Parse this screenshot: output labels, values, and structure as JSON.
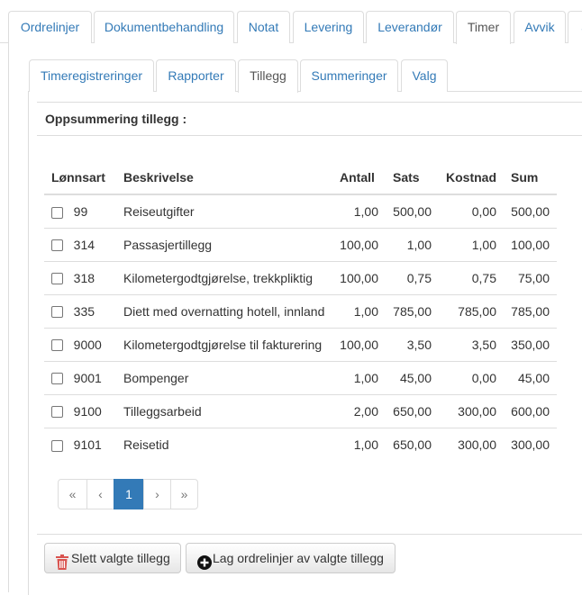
{
  "top_tabs": [
    {
      "label": "Ordrelinjer",
      "active": false
    },
    {
      "label": "Dokumentbehandling",
      "active": false
    },
    {
      "label": "Notat",
      "active": false
    },
    {
      "label": "Levering",
      "active": false
    },
    {
      "label": "Leverandør",
      "active": false
    },
    {
      "label": "Timer",
      "active": true
    },
    {
      "label": "Avvik",
      "active": false
    },
    {
      "label": "S",
      "active": false
    }
  ],
  "sub_tabs": [
    {
      "label": "Timeregistreringer",
      "active": false
    },
    {
      "label": "Rapporter",
      "active": false
    },
    {
      "label": "Tillegg",
      "active": true
    },
    {
      "label": "Summeringer",
      "active": false
    },
    {
      "label": "Valg",
      "active": false
    }
  ],
  "section_title": "Oppsummering tillegg :",
  "table": {
    "headers": [
      "Lønnsart",
      "Beskrivelse",
      "Antall",
      "Sats",
      "Kostnad",
      "Sum"
    ],
    "rows": [
      {
        "code": "99",
        "desc": "Reiseutgifter",
        "antall": "1,00",
        "sats": "500,00",
        "kostnad": "0,00",
        "sum": "500,00"
      },
      {
        "code": "314",
        "desc": "Passasjertillegg",
        "antall": "100,00",
        "sats": "1,00",
        "kostnad": "1,00",
        "sum": "100,00"
      },
      {
        "code": "318",
        "desc": "Kilometergodtgjørelse, trekkpliktig",
        "antall": "100,00",
        "sats": "0,75",
        "kostnad": "0,75",
        "sum": "75,00"
      },
      {
        "code": "335",
        "desc": "Diett med overnatting hotell, innland",
        "antall": "1,00",
        "sats": "785,00",
        "kostnad": "785,00",
        "sum": "785,00"
      },
      {
        "code": "9000",
        "desc": "Kilometergodtgjørelse til fakturering",
        "antall": "100,00",
        "sats": "3,50",
        "kostnad": "3,50",
        "sum": "350,00"
      },
      {
        "code": "9001",
        "desc": "Bompenger",
        "antall": "1,00",
        "sats": "45,00",
        "kostnad": "0,00",
        "sum": "45,00"
      },
      {
        "code": "9100",
        "desc": "Tilleggsarbeid",
        "antall": "2,00",
        "sats": "650,00",
        "kostnad": "300,00",
        "sum": "600,00"
      },
      {
        "code": "9101",
        "desc": "Reisetid",
        "antall": "1,00",
        "sats": "650,00",
        "kostnad": "300,00",
        "sum": "300,00"
      }
    ]
  },
  "pagination": {
    "first": "«",
    "prev": "‹",
    "current": "1",
    "next": "›",
    "last": "»"
  },
  "buttons": {
    "delete_label": "Slett valgte tillegg",
    "create_label": "Lag ordrelinjer av valgte tillegg"
  },
  "colors": {
    "accent": "#337ab7",
    "delete_icon": "#d9534f"
  },
  "icons": {
    "delete": "trash-icon",
    "create": "plus-circle-icon"
  }
}
